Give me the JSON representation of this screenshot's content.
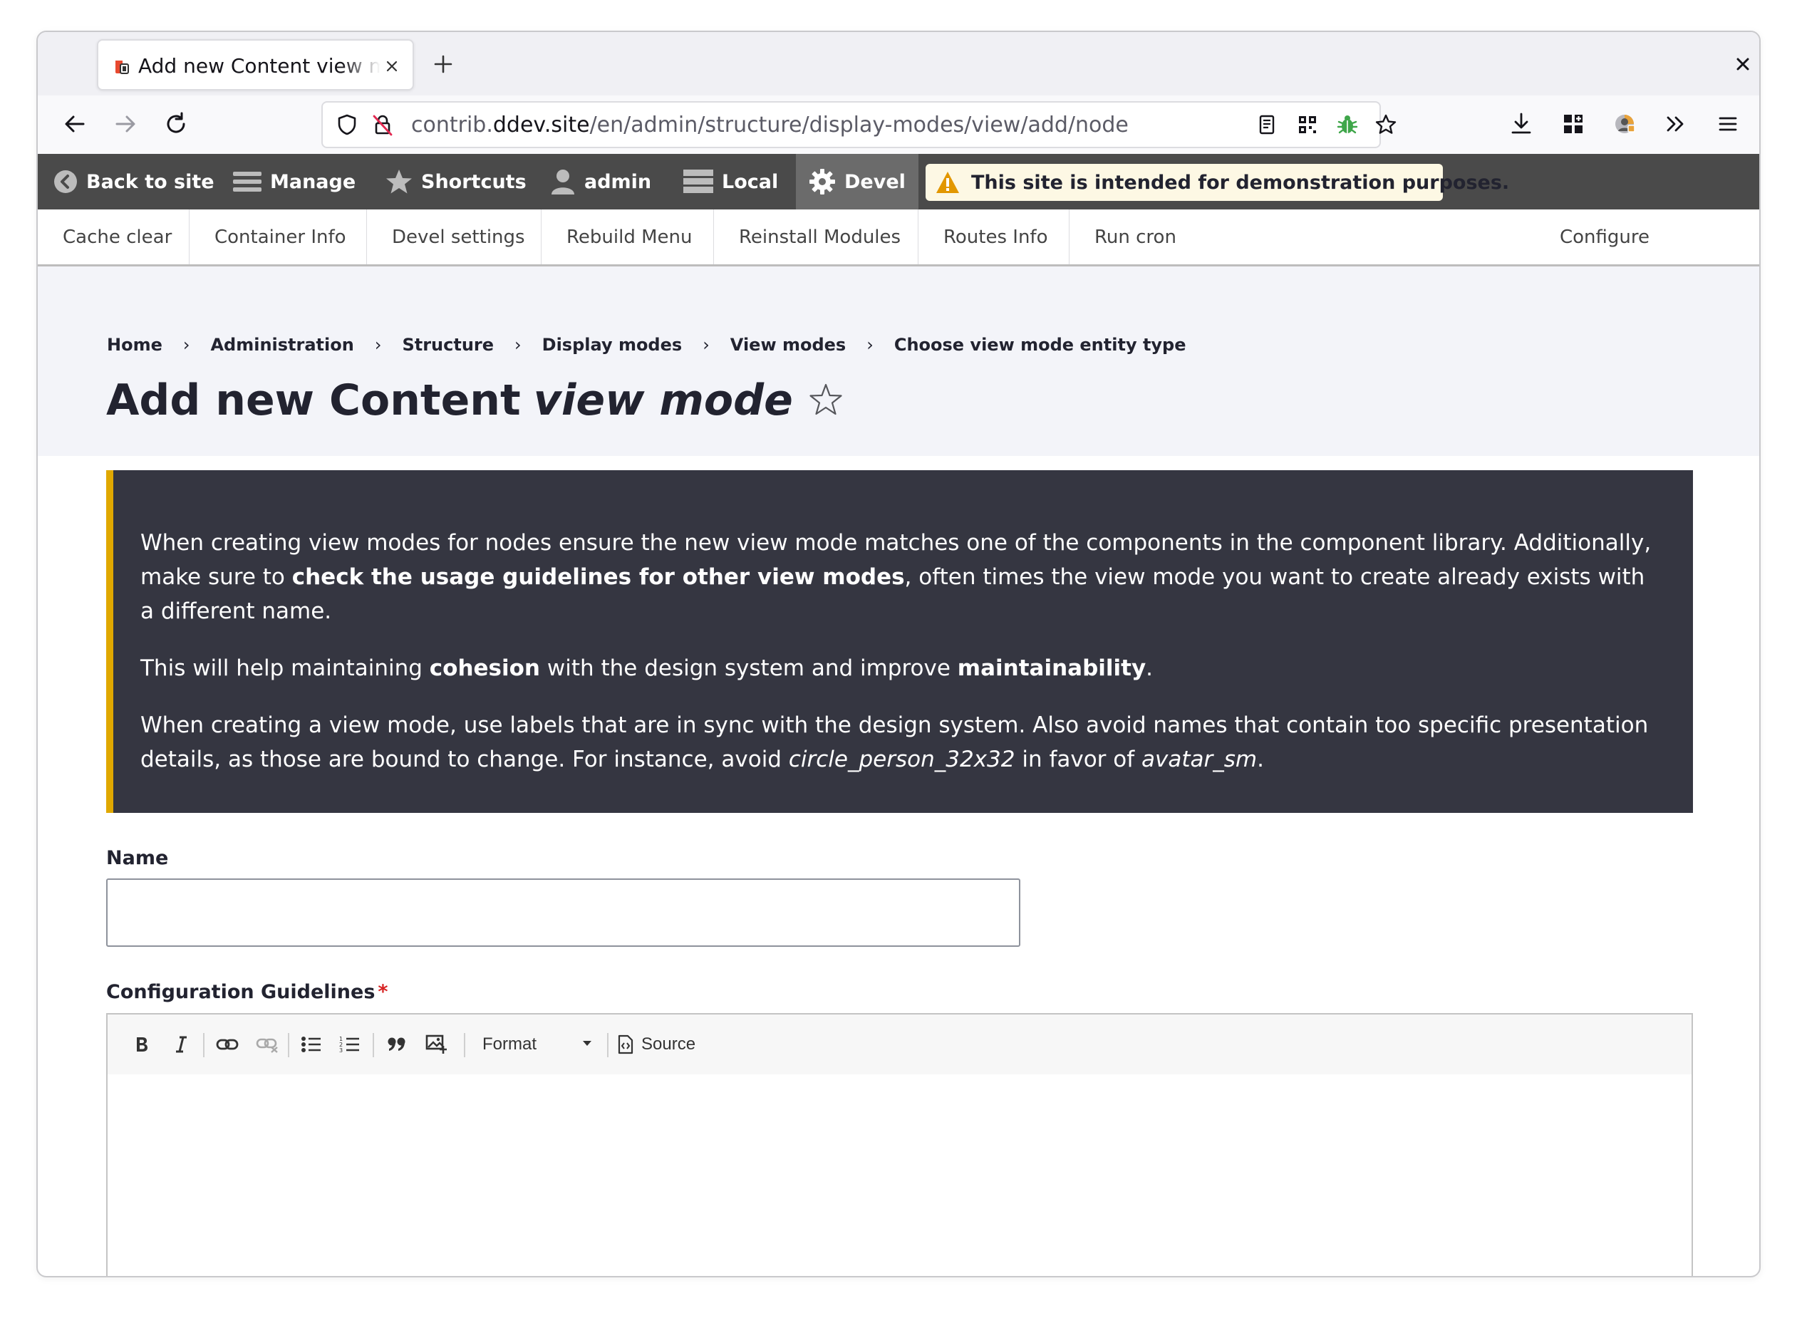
{
  "browser": {
    "tab_title": "Add new Content view mode | Drupal",
    "url_prefix": "contrib.",
    "url_host": "ddev.site",
    "url_path": "/en/admin/structure/display-modes/view/add/node"
  },
  "admin_toolbar": {
    "back_to_site": "Back to site",
    "manage": "Manage",
    "shortcuts": "Shortcuts",
    "user": "admin",
    "local": "Local",
    "devel": "Devel",
    "environment_notice": "This site is intended for demonstration purposes."
  },
  "devel_tray": {
    "items": [
      "Cache clear",
      "Container Info",
      "Devel settings",
      "Rebuild Menu",
      "Reinstall Modules",
      "Routes Info",
      "Run cron"
    ],
    "configure": "Configure"
  },
  "breadcrumb": [
    "Home",
    "Administration",
    "Structure",
    "Display modes",
    "View modes",
    "Choose view mode entity type"
  ],
  "page_title": {
    "main": "Add new Content",
    "emphasis": "view mode"
  },
  "description": {
    "p1_a": "When creating view modes for nodes ensure the new view mode matches one of the components in the component library. Additionally, make sure to ",
    "p1_b": "check the usage guidelines for other view modes",
    "p1_c": ", often times the view mode you want to create already exists with a different name.",
    "p2_a": "This will help maintaining ",
    "p2_b": "cohesion",
    "p2_c": " with the design system and improve ",
    "p2_d": "maintainability",
    "p2_e": ".",
    "p3_a": "When creating a view mode, use labels that are in sync with the design system. Also avoid names that contain too specific presentation details, as those are bound to change. For instance, avoid ",
    "p3_b": "circle_person_32x32",
    "p3_c": " in favor of ",
    "p3_d": "avatar_sm",
    "p3_e": "."
  },
  "form": {
    "name_label": "Name",
    "name_value": "",
    "guidelines_label": "Configuration Guidelines",
    "required_marker": "*",
    "editor": {
      "format_label": "Format",
      "source_label": "Source"
    }
  },
  "colors": {
    "toolbar_bg": "#4a4a4a",
    "header_bg": "#f3f4f9",
    "description_bg": "#353641",
    "description_accent": "#e0a800",
    "required": "#d72222"
  }
}
